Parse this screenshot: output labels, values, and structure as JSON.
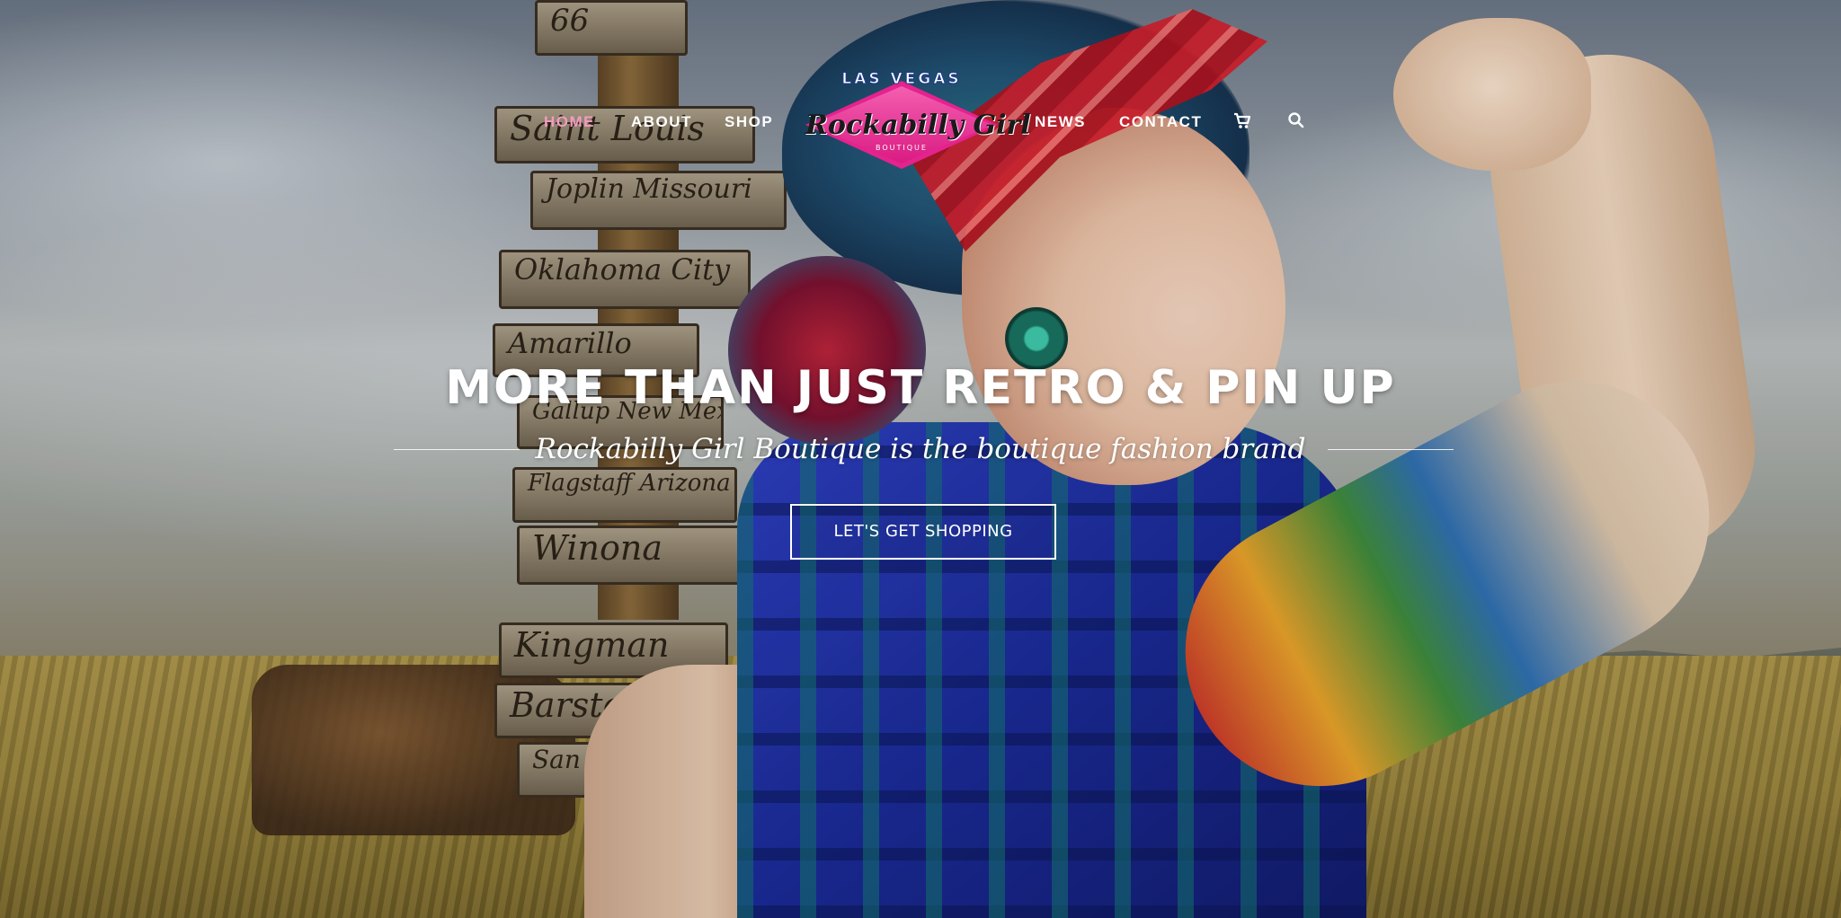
{
  "nav": {
    "items": [
      {
        "label": "HOME",
        "active": true
      },
      {
        "label": "ABOUT",
        "active": false
      },
      {
        "label": "SHOP",
        "active": false
      },
      {
        "label": "NEWS",
        "active": false
      },
      {
        "label": "CONTACT",
        "active": false
      }
    ],
    "icons": [
      "cart-icon",
      "search-icon"
    ],
    "active_color": "#f49ac1"
  },
  "logo": {
    "top_text": "LAS VEGAS",
    "main_text": "Rockabilly Girl",
    "sub_text": "BOUTIQUE",
    "color": "#e5228e"
  },
  "hero": {
    "headline": "MORE THAN JUST RETRO & PIN UP",
    "tagline": "Rockabilly Girl Boutique is the boutique fashion brand",
    "cta_label": "LET'S GET SHOPPING"
  },
  "background": {
    "signs": [
      "66",
      "Saint Louis",
      "Joplin Missouri",
      "Oklahoma City",
      "Amarillo",
      "Gallup New Mexico",
      "Flagstaff Arizona",
      "Winona",
      "Kingman",
      "Barstow",
      "San Bernardino"
    ]
  }
}
